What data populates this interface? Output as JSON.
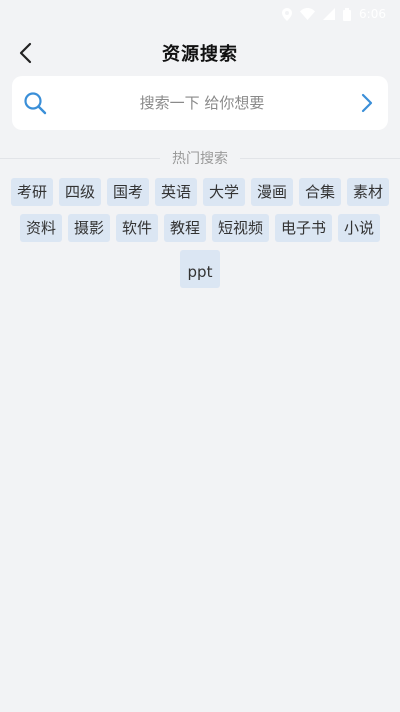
{
  "status_bar": {
    "time": "6:06",
    "icons": [
      "location-icon",
      "wifi-icon",
      "signal-icon",
      "battery-icon"
    ]
  },
  "header": {
    "title": "资源搜索",
    "back_icon": "chevron-left-icon"
  },
  "search": {
    "placeholder": "搜索一下 给你想要",
    "value": "",
    "icon": "search-icon",
    "go_icon": "chevron-right-icon"
  },
  "hot": {
    "title": "热门搜索",
    "tags": [
      "考研",
      "四级",
      "国考",
      "英语",
      "大学",
      "漫画",
      "合集",
      "素材",
      "资料",
      "摄影",
      "软件",
      "教程",
      "短视频",
      "电子书",
      "小说",
      "ppt"
    ]
  },
  "colors": {
    "background": "#f2f3f5",
    "tag_bg": "#dbe6f3",
    "accent": "#3a8fd8",
    "muted_text": "#9a9a9a"
  }
}
